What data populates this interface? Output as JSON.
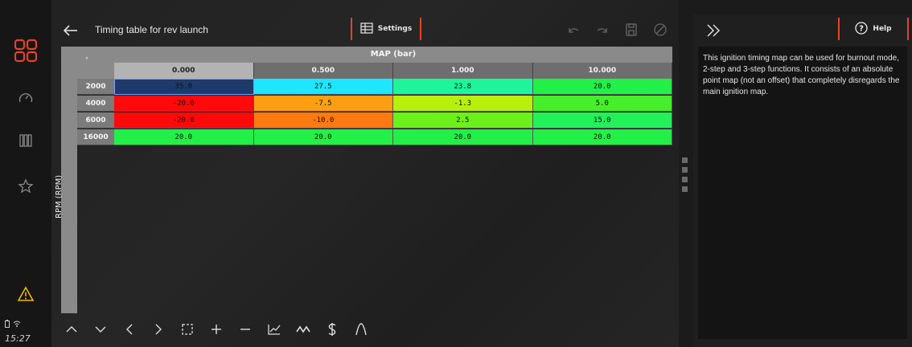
{
  "colors": {
    "accent": "#e3432c",
    "warning": "#f0b400"
  },
  "status_bar": {
    "time": "15:27",
    "icons": [
      "battery-icon",
      "wifi-icon"
    ]
  },
  "rail": {
    "items": [
      {
        "icon": "apps-grid-icon",
        "active": true
      },
      {
        "icon": "gauge-icon"
      },
      {
        "icon": "bars-icon"
      },
      {
        "icon": "star-icon"
      },
      {
        "icon": "warning-icon"
      }
    ]
  },
  "header": {
    "title": "Timing table for rev launch",
    "settings_label": "Settings",
    "tools": [
      "undo-icon",
      "redo-icon",
      "save-icon",
      "disable-icon"
    ]
  },
  "table": {
    "corner_label": "°",
    "x_axis_label": "MAP (bar)",
    "y_axis_label": "RPM (RPM)",
    "columns": [
      "0.000",
      "0.500",
      "1.000",
      "10.000"
    ],
    "rows": [
      {
        "rpm": "2000",
        "values": [
          "35.0",
          "27.5",
          "23.8",
          "20.0"
        ],
        "colors": [
          "#1e3a6b",
          "#1de6ff",
          "#1ef59a",
          "#22f046"
        ]
      },
      {
        "rpm": "4000",
        "values": [
          "-20.0",
          "-7.5",
          "-1.3",
          "5.0"
        ],
        "colors": [
          "#ff0a0a",
          "#ff9f10",
          "#b8f00a",
          "#44f028"
        ]
      },
      {
        "rpm": "6000",
        "values": [
          "-20.0",
          "-10.0",
          "2.5",
          "15.0"
        ],
        "colors": [
          "#ff0a0a",
          "#ff7a10",
          "#6cf01e",
          "#24f05a"
        ]
      },
      {
        "rpm": "16000",
        "values": [
          "20.0",
          "20.0",
          "20.0",
          "20.0"
        ],
        "colors": [
          "#22f046",
          "#22f046",
          "#22f046",
          "#22f046"
        ]
      }
    ]
  },
  "bottom_toolbar": [
    "chevron-up-icon",
    "chevron-down-icon",
    "chevron-left-icon",
    "chevron-right-icon",
    "select-area-icon",
    "plus-icon",
    "minus-icon",
    "interpolate-icon",
    "smooth-icon",
    "dollar-icon",
    "bell-curve-icon"
  ],
  "help": {
    "button_label": "Help",
    "text": "This ignition timing map can be used for burnout mode, 2-step and 3-step functions. It consists of an absolute point map (not an offset) that completely disregards the main ignition map."
  }
}
